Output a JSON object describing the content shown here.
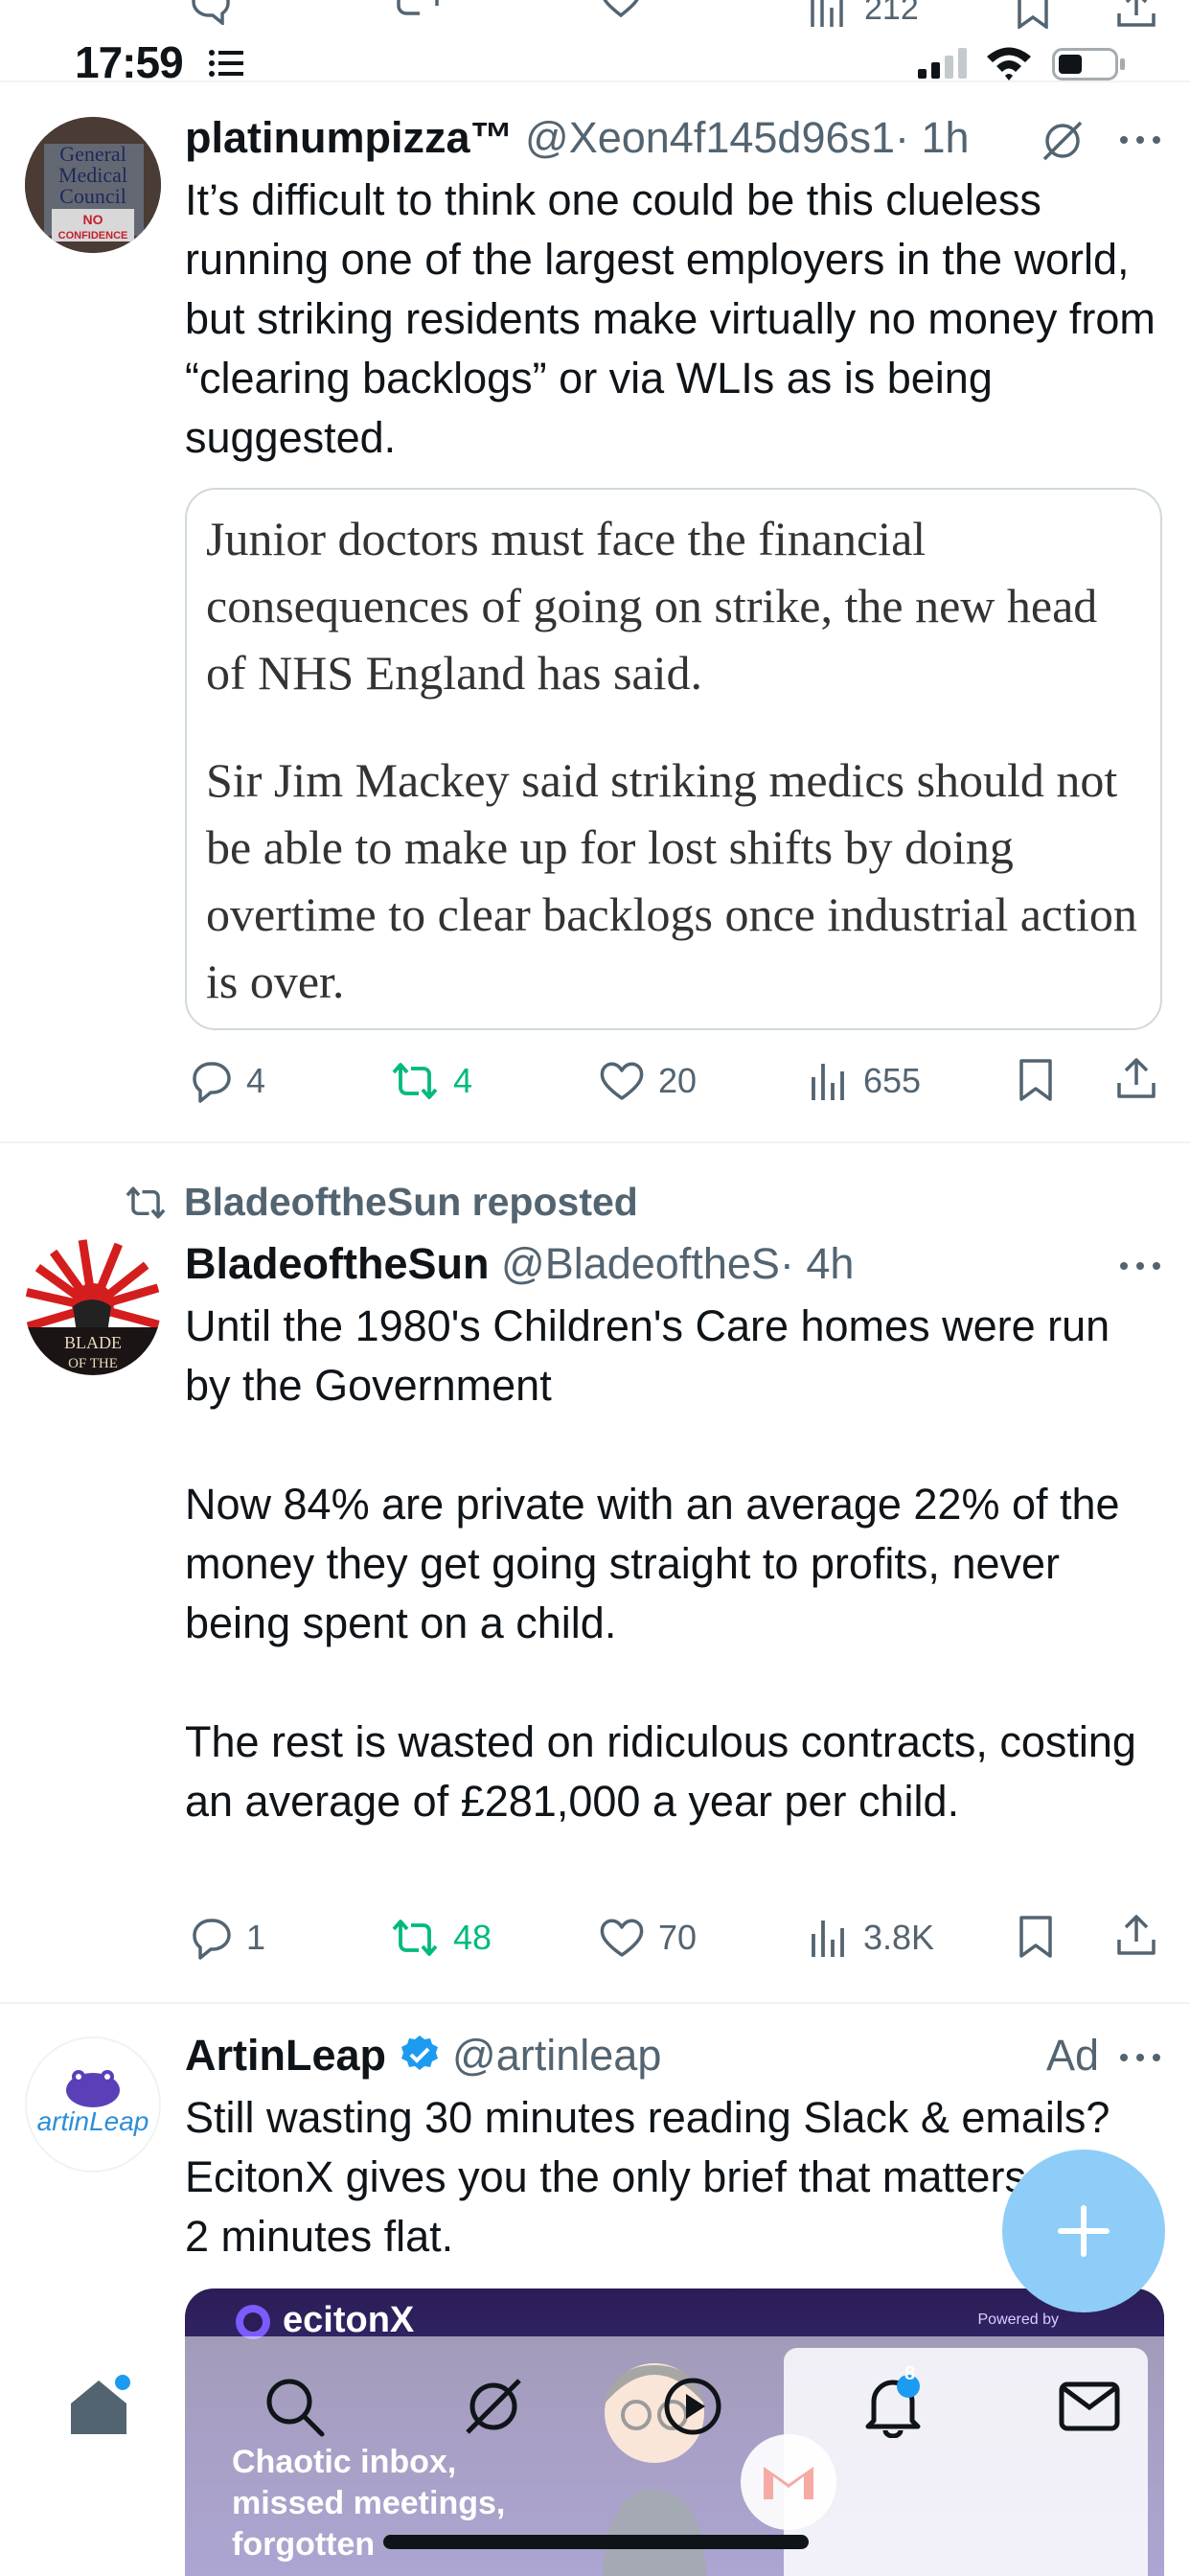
{
  "status_bar": {
    "time": "17:59"
  },
  "prev_tweet": {
    "views": "212"
  },
  "tweets": [
    {
      "name": "platinumpizza™",
      "handle": "@Xeon4f145d96s1",
      "time": "· 1h",
      "text": "It’s difficult to think one could be this clueless running one of the largest employers in the world, but striking residents make virtually no money from “clearing backlogs” or via WLIs as is being suggested.",
      "avatar_text": [
        "General",
        "Medical",
        "Council",
        "NO",
        "CONFIDENCE"
      ],
      "quote": [
        "Junior doctors must face the financial consequences of going on strike, the new head of NHS England has said.",
        "Sir Jim Mackey said striking medics should not be able to make up for lost shifts by doing overtime to clear backlogs once industrial action is over."
      ],
      "replies": "4",
      "reposts": "4",
      "likes": "20",
      "views": "655"
    },
    {
      "reposted_by": "BladeoftheSun reposted",
      "name": "BladeoftheSun",
      "handle": "@BladeoftheS",
      "time": "· 4h",
      "avatar_text": [
        "BLADE",
        "OF THE"
      ],
      "text": "Until the 1980's Children's Care homes were run by the Government\n\nNow 84% are private with an average 22% of the money they get going straight to profits, never being spent on a child.\n\nThe rest is wasted on ridiculous contracts, costing an average of £281,000 a year per child.",
      "replies": "1",
      "reposts": "48",
      "likes": "70",
      "views": "3.8K"
    },
    {
      "name": "ArtinLeap",
      "handle": "@artinleap",
      "ad_label": "Ad",
      "avatar_text": "artinLeap",
      "text": "Still wasting 30 minutes reading Slack & emails? EcitonX gives you the only brief that matters — in 2 minutes flat.",
      "card_brand": "ecitonX",
      "card_powered": "Powered by",
      "card_caption": "Chaotic inbox,\nmissed meetings,\nforgotten"
    }
  ],
  "colors": {
    "accent": "#1d9bf0",
    "repost_green": "#00ba7c",
    "muted": "#536471",
    "verified": "#1d9bf0"
  },
  "tab_bar": {
    "notification_badge": "8"
  }
}
